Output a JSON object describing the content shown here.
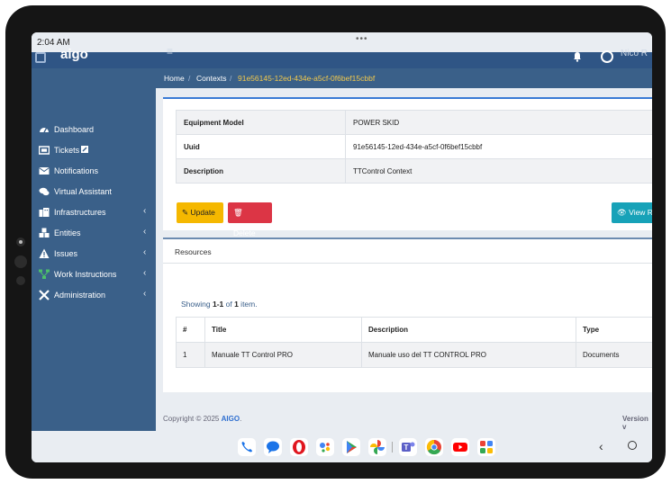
{
  "status_bar": {
    "time": "2:04 AM",
    "dots": "•••"
  },
  "header": {
    "brand": "aigo",
    "user_name": "Nico R"
  },
  "sidebar": {
    "items": [
      {
        "label": "Dashboard",
        "icon": "dashboard-icon",
        "has_children": false
      },
      {
        "label": "Tickets",
        "icon": "ticket-icon",
        "has_children": false
      },
      {
        "label": "Notifications",
        "icon": "envelope-icon",
        "has_children": false
      },
      {
        "label": "Virtual Assistant",
        "icon": "chat-icon",
        "has_children": false
      },
      {
        "label": "Infrastructures",
        "icon": "building-icon",
        "has_children": true
      },
      {
        "label": "Entities",
        "icon": "cubes-icon",
        "has_children": true
      },
      {
        "label": "Issues",
        "icon": "warning-icon",
        "has_children": true
      },
      {
        "label": "Work Instructions",
        "icon": "sitemap-icon",
        "has_children": true
      },
      {
        "label": "Administration",
        "icon": "tools-icon",
        "has_children": true
      }
    ],
    "chevron": "‹"
  },
  "breadcrumb": {
    "items": [
      "Home",
      "Contexts",
      "91e56145-12ed-434e-a5cf-0f6bef15cbbf"
    ]
  },
  "details": {
    "rows": [
      {
        "key": "Equipment Model",
        "value": "POWER SKID"
      },
      {
        "key": "Uuid",
        "value": "91e56145-12ed-434e-a5cf-0f6bef15cbbf"
      },
      {
        "key": "Description",
        "value": "TTControl Context"
      }
    ]
  },
  "actions": {
    "update": "Update",
    "delete": "Delete",
    "view": "View R"
  },
  "resources": {
    "title": "Resources",
    "summary_prefix": "Showing ",
    "summary_range": "1-1",
    "summary_mid": " of ",
    "summary_total": "1",
    "summary_suffix": " item.",
    "columns": [
      "#",
      "Title",
      "Description",
      "Type"
    ],
    "rows": [
      {
        "n": "1",
        "title": "Manuale TT Control PRO",
        "description": "Manuale uso del TT CONTROL PRO",
        "type": "Documents"
      }
    ]
  },
  "footer": {
    "copyright": "Copyright © 2025 ",
    "brand": "AIGO",
    "dot": ".",
    "version": "Version v"
  },
  "colors": {
    "sidebar": "#3a6089",
    "header": "#2f5585",
    "update": "#f5b800",
    "delete": "#dc3545",
    "view": "#17a2b8",
    "crumb_active": "#f2c94c"
  },
  "dock_apps": [
    "phone-icon",
    "messages-icon",
    "opera-icon",
    "assistant-icon",
    "play-store-icon",
    "photos-icon",
    "teams-icon",
    "chrome-icon",
    "youtube-icon",
    "apps-icon"
  ]
}
